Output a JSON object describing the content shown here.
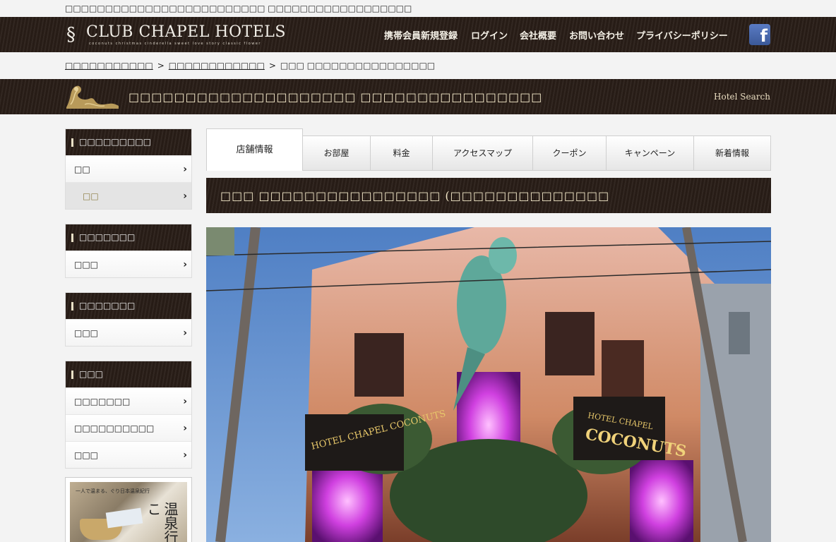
{
  "tagline": "□□□□□□□□□□□□□□□□□□□□□□□□□ □□□□□□□□□□□□□□□□□□",
  "logo": {
    "brand": "CLUB CHAPEL HOTELS",
    "sub": "coconuts  christmas  cinderella  sweet  love  story  classic  flower"
  },
  "nav": [
    "携帯会員新規登録",
    "ログイン",
    "会社概要",
    "お問い合わせ",
    "プライバシーポリシー"
  ],
  "facebook": "f",
  "breadcrumb": {
    "home": "□□□□□□□□□□□",
    "area": "□□□□□□□□□□□□",
    "separator": ">",
    "current": "□□□ □□□□□□□□□□□□□□□□"
  },
  "title_bar": {
    "title": "□□□□□□□□□□□□□□□□□□□□ □□□□□□□□□□□□□□□□",
    "hotel_search": "Hotel  Search"
  },
  "sidebar": [
    {
      "head": "□□□□□□□□□",
      "items": [
        {
          "label": "□□",
          "active": false
        },
        {
          "label": "□□",
          "active": true
        }
      ]
    },
    {
      "head": "□□□□□□□",
      "items": [
        {
          "label": "□□□",
          "active": false
        }
      ]
    },
    {
      "head": "□□□□□□□",
      "items": [
        {
          "label": "□□□",
          "active": false
        }
      ]
    },
    {
      "head": "□□□",
      "items": [
        {
          "label": "□□□□□□□",
          "active": false
        },
        {
          "label": "□□□□□□□□□□",
          "active": false
        },
        {
          "label": "□□□",
          "active": false
        }
      ]
    }
  ],
  "chevron": "›",
  "banner": {
    "caption": "一人で温まる、ぐり日本温泉紀行",
    "vertical": "温泉行こ"
  },
  "tabs": [
    "店舗情報",
    "お部屋",
    "料金",
    "アクセスマップ",
    "クーポン",
    "キャンペーン",
    "新着情報"
  ],
  "hotel_name": "□□□ □□□□□□□□□□□□□□□□ (□□□□□□□□□□□□□□",
  "photo": {
    "sign_left": "HOTEL CHAPEL COCONUTS",
    "sign_right": "COCONUTS",
    "sign_right_top": "HOTEL CHAPEL"
  }
}
